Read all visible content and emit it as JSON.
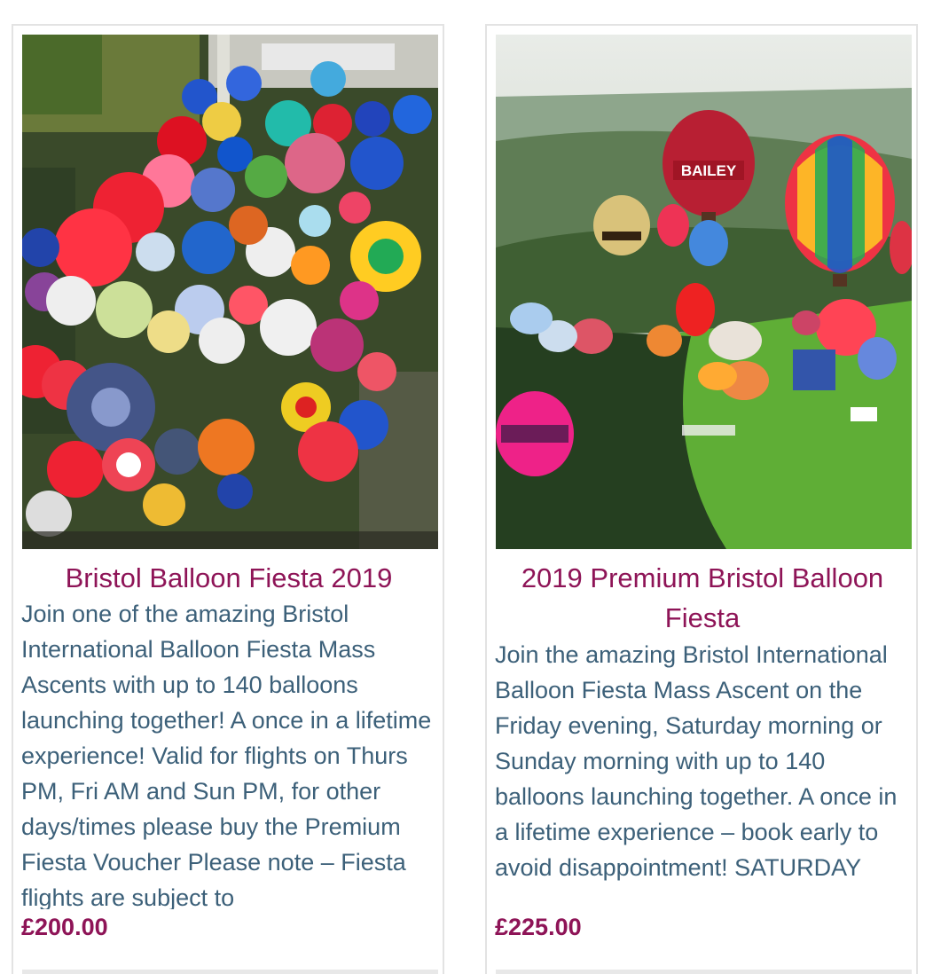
{
  "products": [
    {
      "title": "Bristol Balloon Fiesta 2019",
      "description": "Join one of the amazing Bristol International Balloon Fiesta Mass Ascents with up to 140 balloons launching together! A once in a lifetime experience! Valid for flights on Thurs PM, Fri AM and Sun PM, for other days/times please buy the Premium Fiesta Voucher Please note – Fiesta flights are subject to",
      "price": "£200.00",
      "image_alt": "aerial-balloon-field-photo"
    },
    {
      "title": "2019 Premium Bristol Balloon Fiesta",
      "description": "Join the amazing Bristol International Balloon Fiesta Mass Ascent on the Friday evening, Saturday morning or Sunday morning with up to 140 balloons launching together. A once in a lifetime experience – book early to avoid disappointment! SATURDAY",
      "price": "£225.00",
      "image_alt": "balloons-over-hills-photo",
      "balloon_text": "BAILEY"
    }
  ],
  "colors": {
    "title": "#8e1457",
    "description": "#3c6079",
    "price": "#8e1457",
    "card_border": "#e3e3e3"
  }
}
